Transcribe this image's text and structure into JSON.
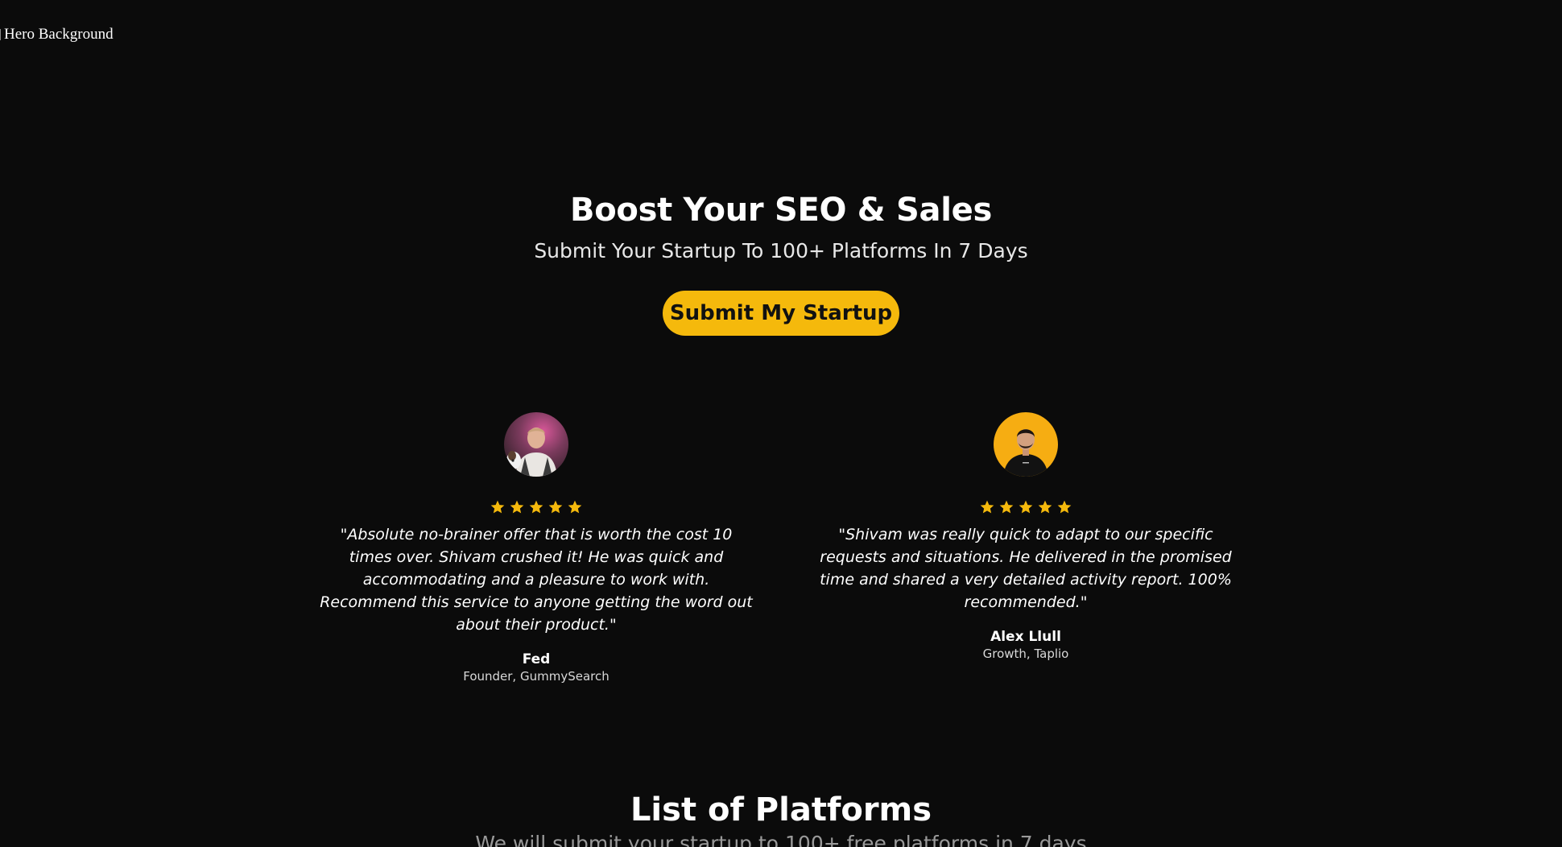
{
  "hero": {
    "background_alt": "Hero Background",
    "title": "Boost Your SEO & Sales",
    "subtitle": "Submit Your Startup To 100+ Platforms In 7 Days",
    "cta_label": "Submit My Startup"
  },
  "colors": {
    "background": "#0b0b0b",
    "accent": "#f5b90c",
    "star": "#f5b90c"
  },
  "testimonials": [
    {
      "rating": 5,
      "quote": "\"Absolute no-brainer offer that is worth the cost 10 times over. Shivam crushed it! He was quick and accommodating and a pleasure to work with. Recommend this service to anyone getting the word out about their product.\"",
      "name": "Fed",
      "role": "Founder, GummySearch"
    },
    {
      "rating": 5,
      "quote": "\"Shivam was really quick to adapt to our specific requests and situations. He delivered in the promised time and shared a very detailed activity report. 100% recommended.\"",
      "name": "Alex Llull",
      "role": "Growth, Taplio"
    }
  ],
  "platforms": {
    "title": "List of Platforms",
    "subtitle": "We will submit your startup to 100+ free platforms in 7 days"
  }
}
